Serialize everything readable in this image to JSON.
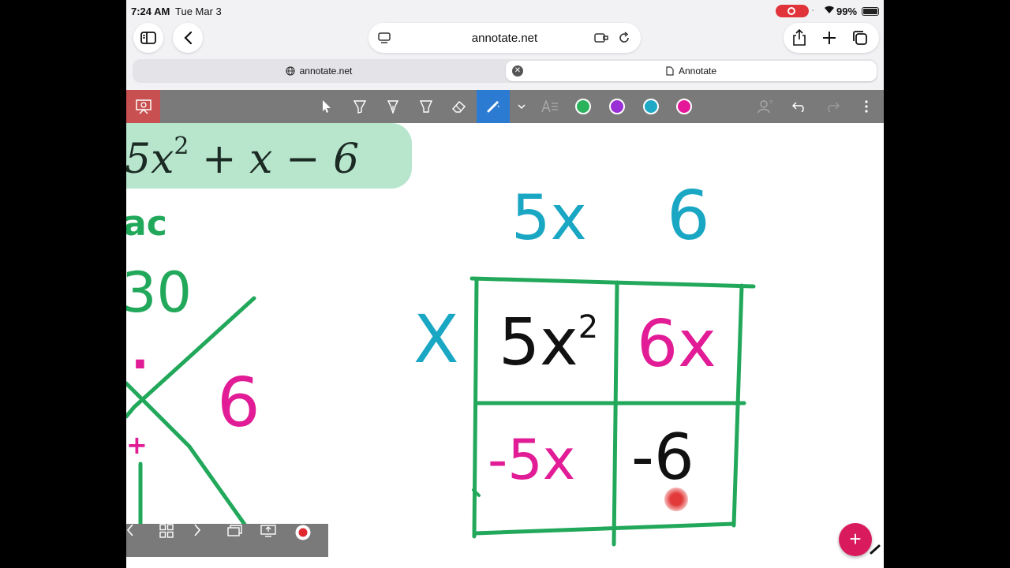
{
  "status_bar": {
    "time": "7:24 AM",
    "date": "Tue Mar 3",
    "battery": "99%",
    "recording_color": "#e0333a"
  },
  "browser": {
    "url": "annotate.net",
    "tabs": [
      {
        "label": "annotate.net",
        "icon": "globe-icon"
      },
      {
        "label": "Annotate",
        "icon": "document-icon",
        "active": true
      }
    ]
  },
  "annotate_toolbar": {
    "active_tool": "laser-pointer",
    "tools": [
      "select",
      "highlighter",
      "pen",
      "marker",
      "eraser",
      "laser-pointer"
    ],
    "colors": [
      "#2bb35c",
      "#9b2fd6",
      "#1fa9c6",
      "#e6189a"
    ]
  },
  "canvas": {
    "equation": {
      "lead": "5x",
      "exp": "2",
      "rest": " + x − 6"
    },
    "handwriting": {
      "ac_label": "ac",
      "product": "30",
      "factor_a": "·",
      "factor_right": "6",
      "plus_mark": "+",
      "top_left": "5x",
      "top_right": "6",
      "side": "X",
      "cell_11": "5x",
      "cell_11_exp": "2",
      "cell_12": "6x",
      "cell_21": "-5x",
      "cell_22": "-6"
    },
    "ink_colors": {
      "green": "#22a85a",
      "blue": "#1aa7c4",
      "pink": "#e11c96",
      "black": "#111111"
    }
  },
  "fab_label": "+"
}
